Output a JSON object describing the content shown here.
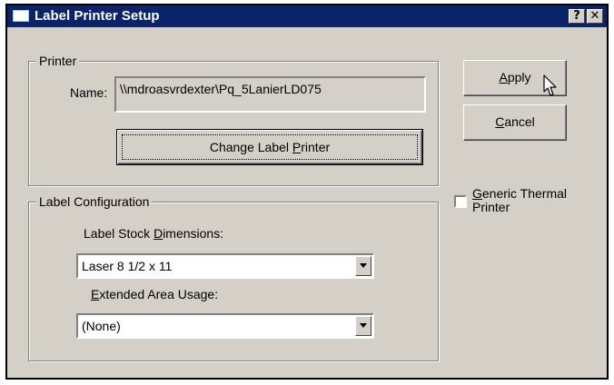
{
  "window": {
    "title": "Label Printer Setup",
    "help_button": "?",
    "close_button": "✕"
  },
  "printer_group": {
    "legend": "Printer",
    "name_label": "Name:",
    "name_value": "\\\\mdroasvrdexter\\Pq_5LanierLD075",
    "change_button": {
      "before": "Change Label ",
      "key": "P",
      "after": "rinter"
    }
  },
  "label_config_group": {
    "legend": "Label Configuration",
    "stock_label": {
      "before": "Label Stock ",
      "key": "D",
      "after": "imensions:"
    },
    "stock_value": "Laser 8 1/2 x 11",
    "extended_label": {
      "before": "",
      "key": "E",
      "after": "xtended Area Usage:"
    },
    "extended_value": "(None)"
  },
  "buttons": {
    "apply": {
      "before": "",
      "key": "A",
      "after": "pply"
    },
    "cancel": {
      "before": "",
      "key": "C",
      "after": "ancel"
    }
  },
  "generic_thermal": {
    "line1": {
      "before": "",
      "key": "G",
      "after": "eneric Thermal"
    },
    "line2": "Printer",
    "checked": false
  }
}
